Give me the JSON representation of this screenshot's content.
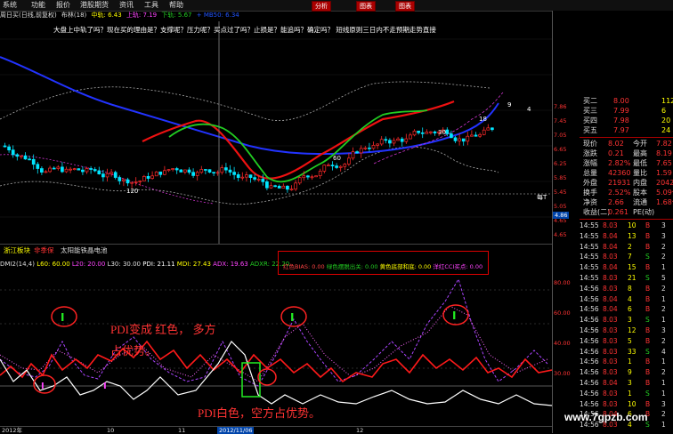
{
  "menu": {
    "items": [
      "系统",
      "功能",
      "报价",
      "港股期货",
      "资讯",
      "工具",
      "帮助"
    ],
    "tabs": [
      "分析",
      "图表",
      "图表"
    ]
  },
  "info_bar": {
    "period": "周日买(日线,前复权)",
    "name": "布林(18)",
    "mid_label": "中轨: 6.43",
    "upper_label": "上轨: 7.19",
    "lower_label": "下轨: 5.67",
    "extra": "+  MB50: 6.34"
  },
  "ticker_text": "大盘上中轨了吗？现在买的理由是？支撑呢？压力呢？买点过了吗？止损是？能追吗？确定吗？ 短线原则三日内不走预期走势直接",
  "price_labels": {
    "high_marker": "9",
    "high_marker2": "4",
    "mid_marker": "18",
    "marker30": "30",
    "marker60": "60",
    "marker120": "120",
    "low_box": "4.86",
    "cur_tag": "每T"
  },
  "main_axis": [
    "7.86",
    "7.45",
    "7.05",
    "6.65",
    "6.25",
    "5.85",
    "5.45",
    "5.05",
    "4.65",
    "4.65"
  ],
  "quote": {
    "rows": [
      {
        "label": "买二",
        "price": "8.00",
        "vol": "112"
      },
      {
        "label": "买三",
        "price": "7.99",
        "vol": "6"
      },
      {
        "label": "买四",
        "price": "7.98",
        "vol": "20"
      },
      {
        "label": "买五",
        "price": "7.97",
        "vol": "24"
      }
    ],
    "stats": [
      {
        "l1": "现价",
        "v1": "8.02",
        "l2": "今开",
        "v2": "7.82"
      },
      {
        "l1": "涨跌",
        "v1": "0.21",
        "l2": "最高",
        "v2": "8.19"
      },
      {
        "l1": "涨幅",
        "v1": "2.82%",
        "l2": "最低",
        "v2": "7.65"
      },
      {
        "l1": "总量",
        "v1": "42360",
        "l2": "量比",
        "v2": "1.59"
      },
      {
        "l1": "外盘",
        "v1": "21931",
        "l2": "内盘",
        "v2": "20429"
      },
      {
        "l1": "换手",
        "v1": "2.52%",
        "l2": "股本",
        "v2": "5.09亿"
      },
      {
        "l1": "净资",
        "v1": "2.66",
        "l2": "流通",
        "v2": "1.68亿"
      },
      {
        "l1": "收益(二)",
        "v1": "0.261",
        "l2": "PE(动)",
        "v2": ""
      }
    ],
    "ticks": [
      {
        "t": "14:55",
        "p": "8.03",
        "v": "10",
        "s": "B",
        "n": "3"
      },
      {
        "t": "14:55",
        "p": "8.04",
        "v": "13",
        "s": "B",
        "n": "3"
      },
      {
        "t": "14:55",
        "p": "8.04",
        "v": "2",
        "s": "B",
        "n": "2"
      },
      {
        "t": "14:55",
        "p": "8.03",
        "v": "7",
        "s": "S",
        "n": "2"
      },
      {
        "t": "14:55",
        "p": "8.04",
        "v": "15",
        "s": "B",
        "n": "1"
      },
      {
        "t": "14:55",
        "p": "8.03",
        "v": "21",
        "s": "S",
        "n": "5"
      },
      {
        "t": "14:56",
        "p": "8.03",
        "v": "8",
        "s": "B",
        "n": "2"
      },
      {
        "t": "14:56",
        "p": "8.04",
        "v": "4",
        "s": "B",
        "n": "1"
      },
      {
        "t": "14:56",
        "p": "8.04",
        "v": "6",
        "s": "B",
        "n": "2"
      },
      {
        "t": "14:56",
        "p": "8.03",
        "v": "3",
        "s": "S",
        "n": "1"
      },
      {
        "t": "14:56",
        "p": "8.03",
        "v": "12",
        "s": "B",
        "n": "3"
      },
      {
        "t": "14:56",
        "p": "8.03",
        "v": "5",
        "s": "B",
        "n": "2"
      },
      {
        "t": "14:56",
        "p": "8.03",
        "v": "33",
        "s": "S",
        "n": "4"
      },
      {
        "t": "14:56",
        "p": "8.03",
        "v": "1",
        "s": "B",
        "n": "1"
      },
      {
        "t": "14:56",
        "p": "8.03",
        "v": "9",
        "s": "B",
        "n": "2"
      },
      {
        "t": "14:56",
        "p": "8.04",
        "v": "3",
        "s": "B",
        "n": "1"
      },
      {
        "t": "14:56",
        "p": "8.03",
        "v": "1",
        "s": "S",
        "n": "1"
      },
      {
        "t": "14:56",
        "p": "8.03",
        "v": "10",
        "s": "B",
        "n": "3"
      },
      {
        "t": "14:56",
        "p": "8.04",
        "v": "6",
        "s": "B",
        "n": "2"
      },
      {
        "t": "14:56",
        "p": "8.03",
        "v": "4",
        "s": "S",
        "n": "1"
      },
      {
        "t": "14:56",
        "p": "8.03",
        "v": "2",
        "s": "B",
        "n": "1"
      },
      {
        "t": "14:56",
        "p": "8.03",
        "v": "1",
        "s": "B",
        "n": "1"
      },
      {
        "t": "14:56",
        "p": "8.04",
        "v": "5",
        "s": "B",
        "n": "2"
      },
      {
        "t": "14:56",
        "p": "8.03",
        "v": "7",
        "s": "S",
        "n": "2"
      },
      {
        "t": "14:56",
        "p": "8.03",
        "v": "18",
        "s": "B",
        "n": "3"
      },
      {
        "t": "14:56",
        "p": "8.03",
        "v": "2",
        "s": "B",
        "n": "1"
      },
      {
        "t": "14:56",
        "p": "8.03",
        "v": "1",
        "s": "B",
        "n": "1"
      },
      {
        "t": "14:56",
        "p": "8.02",
        "v": "3",
        "s": "S",
        "n": "1"
      },
      {
        "t": "14:56",
        "p": "8.02",
        "v": "13",
        "s": "B",
        "n": "4"
      },
      {
        "t": "14:56",
        "p": "8.03",
        "v": "2",
        "s": "B",
        "n": "1"
      },
      {
        "t": "14:56",
        "p": "8.03",
        "v": "6",
        "s": "B",
        "n": "2"
      },
      {
        "t": "14:56",
        "p": "8.02",
        "v": "9",
        "s": "B",
        "n": "2"
      }
    ]
  },
  "sector_bar": {
    "a": "浙江板块",
    "b": "非季保",
    "c": "太阳能铁晶电池"
  },
  "indicator": {
    "name": "DMI2(14,4)",
    "l60": "L60: 60.00",
    "l20": "L20: 20.00",
    "l30": "L30: 30.00",
    "pdi": "PDI: 21.11",
    "mdi": "MDI: 27.43",
    "adx": "ADX: 19.63",
    "adxr": "ADXR: 22.20"
  },
  "signals": {
    "red_bias": "红色BIAS: 0.00",
    "green_out": "绿色摆脱出关: 0.00",
    "yellow_bottom": "黄色底部和底: 0.00",
    "cci": "洋红CCI买点: 0.00"
  },
  "ind_axis": [
    "80.00",
    "60.00",
    "40.00",
    "30.00"
  ],
  "annotations": {
    "n1": "PDI变成  红色，  多方",
    "n2": "占优势。",
    "n3": "PDI白色，空方占优势。",
    "mark_i": "I"
  },
  "date_labels": [
    "2012年",
    "10",
    "11",
    "2012/11/06",
    "12"
  ],
  "watermark": "www.7gpzb.com",
  "colors": {
    "up": "#ff2a2a",
    "down": "#00e5ff",
    "yellow": "#ffff00",
    "ma_blue": "#2233ff",
    "ma_red": "#ee1111",
    "ma_green": "#22cc22"
  }
}
